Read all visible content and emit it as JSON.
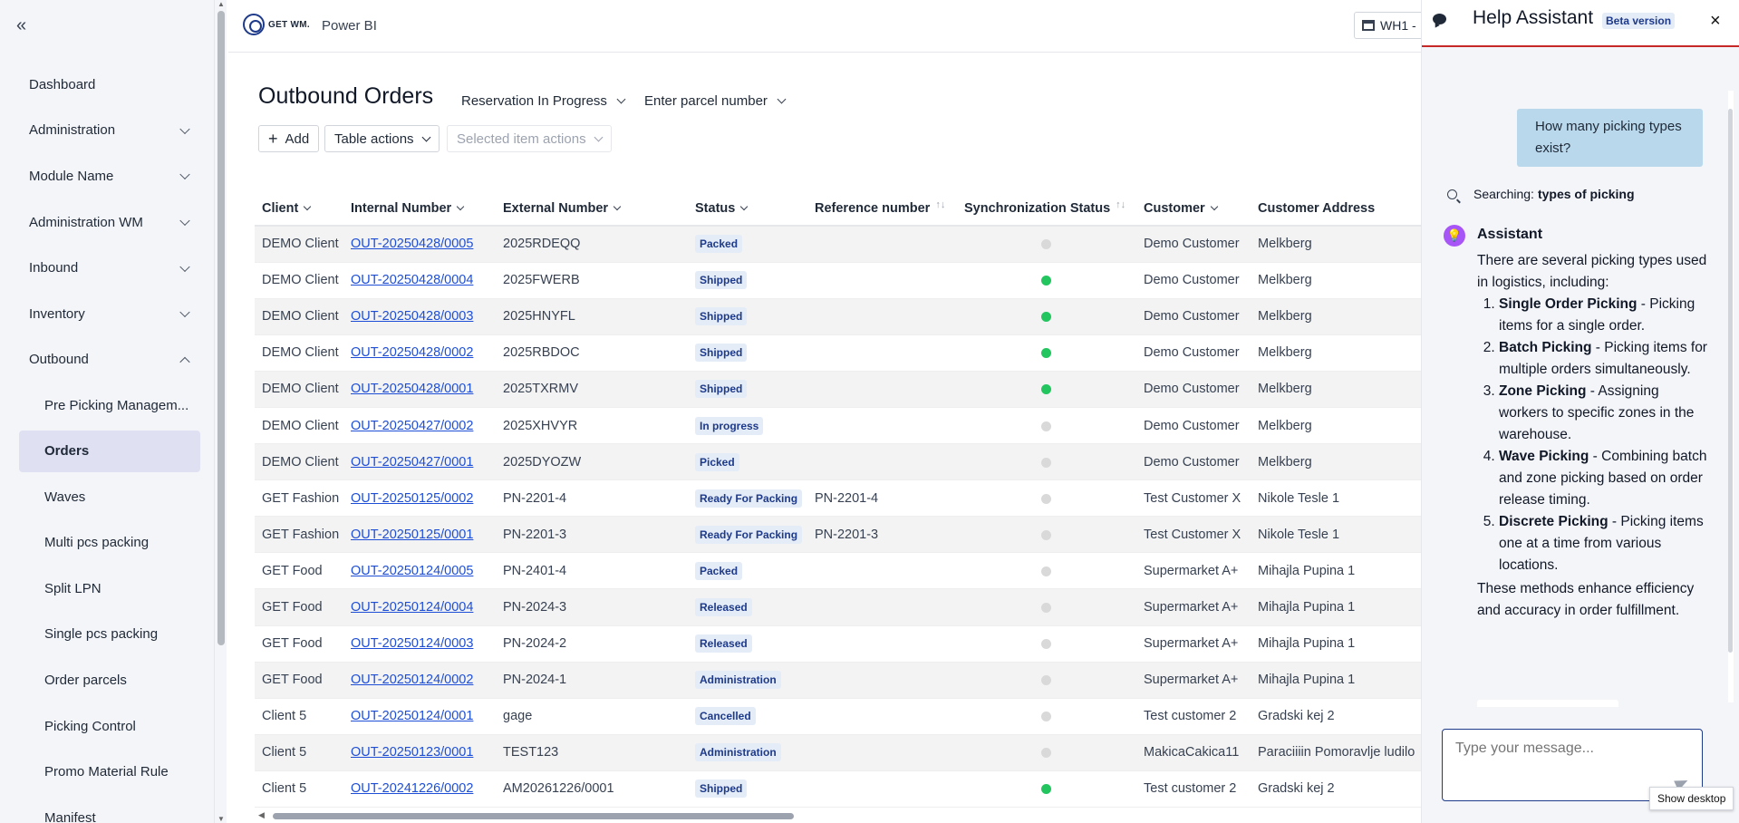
{
  "sidebar": {
    "collapse_label": "«",
    "items": [
      {
        "label": "Dashboard",
        "chevron": false
      },
      {
        "label": "Administration",
        "chevron": true
      },
      {
        "label": "Module Name",
        "chevron": true
      },
      {
        "label": "Administration WM",
        "chevron": true
      },
      {
        "label": "Inbound",
        "chevron": true
      },
      {
        "label": "Inventory",
        "chevron": true
      },
      {
        "label": "Outbound",
        "chevron": true,
        "expanded": true
      }
    ],
    "sub_items": [
      {
        "label": "Pre Picking Managem..."
      },
      {
        "label": "Orders",
        "active": true
      },
      {
        "label": "Waves"
      },
      {
        "label": "Multi pcs packing"
      },
      {
        "label": "Split LPN"
      },
      {
        "label": "Single pcs packing"
      },
      {
        "label": "Order parcels"
      },
      {
        "label": "Picking Control"
      },
      {
        "label": "Promo Material Rule"
      },
      {
        "label": "Manifest"
      }
    ]
  },
  "topbar": {
    "logo_text": "GET WM.",
    "powerbi_label": "Power BI",
    "warehouse_label": "WH1 -"
  },
  "main": {
    "title": "Outbound Orders",
    "filter_status": "Reservation In Progress",
    "filter_parcel": "Enter parcel number",
    "add_label": "Add",
    "table_actions_label": "Table actions",
    "selected_actions_label": "Selected item actions"
  },
  "table": {
    "columns": [
      "Client",
      "Internal Number",
      "External Number",
      "Status",
      "Reference number",
      "Synchronization Status",
      "Customer",
      "Customer Address"
    ],
    "rows": [
      {
        "client": "DEMO Client",
        "internal": "OUT-20250428/0005",
        "external": "2025RDEQQ",
        "status": "Packed",
        "reference": "",
        "sync": "gray",
        "customer": "Demo Customer",
        "address": "Melkberg"
      },
      {
        "client": "DEMO Client",
        "internal": "OUT-20250428/0004",
        "external": "2025FWERB",
        "status": "Shipped",
        "reference": "",
        "sync": "green",
        "customer": "Demo Customer",
        "address": "Melkberg"
      },
      {
        "client": "DEMO Client",
        "internal": "OUT-20250428/0003",
        "external": "2025HNYFL",
        "status": "Shipped",
        "reference": "",
        "sync": "green",
        "customer": "Demo Customer",
        "address": "Melkberg"
      },
      {
        "client": "DEMO Client",
        "internal": "OUT-20250428/0002",
        "external": "2025RBDOC",
        "status": "Shipped",
        "reference": "",
        "sync": "green",
        "customer": "Demo Customer",
        "address": "Melkberg"
      },
      {
        "client": "DEMO Client",
        "internal": "OUT-20250428/0001",
        "external": "2025TXRMV",
        "status": "Shipped",
        "reference": "",
        "sync": "green",
        "customer": "Demo Customer",
        "address": "Melkberg"
      },
      {
        "client": "DEMO Client",
        "internal": "OUT-20250427/0002",
        "external": "2025XHVYR",
        "status": "In progress",
        "reference": "",
        "sync": "gray",
        "customer": "Demo Customer",
        "address": "Melkberg"
      },
      {
        "client": "DEMO Client",
        "internal": "OUT-20250427/0001",
        "external": "2025DYOZW",
        "status": "Picked",
        "reference": "",
        "sync": "gray",
        "customer": "Demo Customer",
        "address": "Melkberg"
      },
      {
        "client": "GET Fashion",
        "internal": "OUT-20250125/0002",
        "external": "PN-2201-4",
        "status": "Ready For Packing",
        "reference": "PN-2201-4",
        "sync": "gray",
        "customer": "Test Customer X",
        "address": "Nikole Tesle 1"
      },
      {
        "client": "GET Fashion",
        "internal": "OUT-20250125/0001",
        "external": "PN-2201-3",
        "status": "Ready For Packing",
        "reference": "PN-2201-3",
        "sync": "gray",
        "customer": "Test Customer X",
        "address": "Nikole Tesle 1"
      },
      {
        "client": "GET Food",
        "internal": "OUT-20250124/0005",
        "external": "PN-2401-4",
        "status": "Packed",
        "reference": "",
        "sync": "gray",
        "customer": "Supermarket A+",
        "address": "Mihajla Pupina 1"
      },
      {
        "client": "GET Food",
        "internal": "OUT-20250124/0004",
        "external": "PN-2024-3",
        "status": "Released",
        "reference": "",
        "sync": "gray",
        "customer": "Supermarket A+",
        "address": "Mihajla Pupina 1"
      },
      {
        "client": "GET Food",
        "internal": "OUT-20250124/0003",
        "external": "PN-2024-2",
        "status": "Released",
        "reference": "",
        "sync": "gray",
        "customer": "Supermarket A+",
        "address": "Mihajla Pupina 1"
      },
      {
        "client": "GET Food",
        "internal": "OUT-20250124/0002",
        "external": "PN-2024-1",
        "status": "Administration",
        "reference": "",
        "sync": "gray",
        "customer": "Supermarket A+",
        "address": "Mihajla Pupina 1"
      },
      {
        "client": "Client 5",
        "internal": "OUT-20250124/0001",
        "external": "gage",
        "status": "Cancelled",
        "reference": "",
        "sync": "gray",
        "customer": "Test customer 2",
        "address": "Gradski kej 2"
      },
      {
        "client": "Client 5",
        "internal": "OUT-20250123/0001",
        "external": "TEST123",
        "status": "Administration",
        "reference": "",
        "sync": "gray",
        "customer": "MakicaCakica11",
        "address": "Paraciiiin Pomoravlje ludilo"
      },
      {
        "client": "Client 5",
        "internal": "OUT-20241226/0002",
        "external": "AM20261226/0001",
        "status": "Shipped",
        "reference": "",
        "sync": "green",
        "customer": "Test customer 2",
        "address": "Gradski kej 2"
      }
    ]
  },
  "assistant": {
    "title": "Help Assistant",
    "beta_label": "Beta version",
    "close_label": "×",
    "user_question": "How many picking types exist?",
    "searching_label": "Searching:",
    "searching_query": "types of picking",
    "assistant_name": "Assistant",
    "avatar_glyph": "💡",
    "intro": "There are several picking types used in logistics, including:",
    "types": [
      {
        "name": "Single Order Picking",
        "desc": " - Picking items for a single order."
      },
      {
        "name": "Batch Picking",
        "desc": " - Picking items for multiple orders simultaneously."
      },
      {
        "name": "Zone Picking",
        "desc": " - Assigning workers to specific zones in the warehouse."
      },
      {
        "name": "Wave Picking",
        "desc": " - Combining batch and zone picking based on order release timing."
      },
      {
        "name": "Discrete Picking",
        "desc": " - Picking items one at a time from various locations."
      }
    ],
    "outro": "These methods enhance efficiency and accuracy in order fulfillment.",
    "input_placeholder": "Type your message..."
  },
  "tooltip": {
    "label": "Show desktop"
  },
  "colors": {
    "accent": "#1e3a8a",
    "link": "#1d4ed8",
    "sync_green": "#22c55e",
    "sync_gray": "#d9d9d9",
    "header_line": "#c62828"
  }
}
